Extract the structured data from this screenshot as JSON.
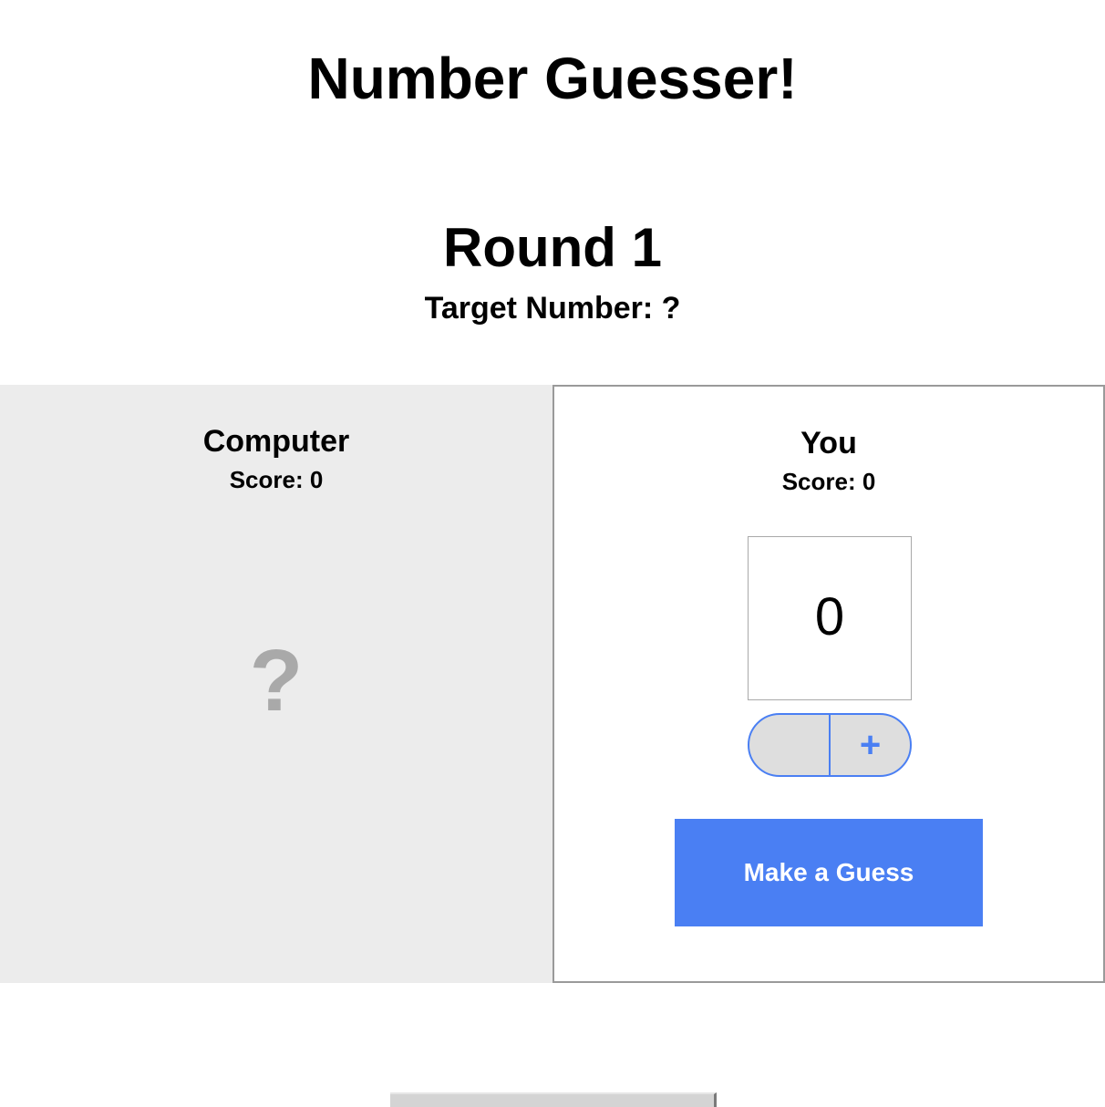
{
  "app": {
    "title": "Number Guesser!"
  },
  "round": {
    "title": "Round 1",
    "target_label": "Target Number: ?"
  },
  "computer": {
    "name": "Computer",
    "score_label": "Score: 0",
    "guess": "?"
  },
  "human": {
    "name": "You",
    "score_label": "Score: 0",
    "guess_value": "0",
    "decrement_label": "–",
    "increment_label": "+",
    "guess_button_label": "Make a Guess"
  },
  "colors": {
    "accent": "#4a7ff3",
    "computer_panel_bg": "#ececec",
    "muted_text": "#a9a9a9"
  }
}
